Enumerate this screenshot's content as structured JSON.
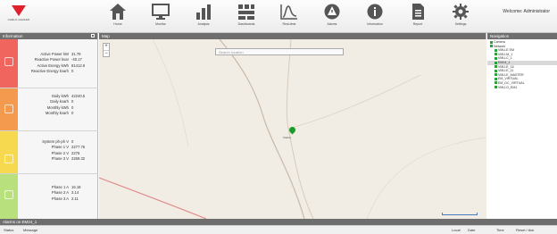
{
  "brand": {
    "logo_text": "CARLO GAVAZZI"
  },
  "toolbar": {
    "items": [
      {
        "label": "Home",
        "icon": "home-icon"
      },
      {
        "label": "Monitor",
        "icon": "monitor-icon"
      },
      {
        "label": "Analysis",
        "icon": "bar-chart-icon"
      },
      {
        "label": "Dashboards",
        "icon": "dashboard-icon"
      },
      {
        "label": "Real-time",
        "icon": "line-chart-icon"
      },
      {
        "label": "Alarms",
        "icon": "alarm-icon"
      },
      {
        "label": "Information",
        "icon": "info-icon"
      },
      {
        "label": "Report",
        "icon": "report-icon"
      },
      {
        "label": "Settings",
        "icon": "gear-icon"
      }
    ],
    "welcome": "Welcome: Administrator"
  },
  "info_panel": {
    "title": "Information",
    "sections": [
      {
        "rows": [
          {
            "label": "Active Power kW",
            "value": "31.79"
          },
          {
            "label": "Reactive Power kvar",
            "value": "-40.17"
          },
          {
            "label": "Active Energy kWh",
            "value": "81412.9"
          },
          {
            "label": "Reactive Energy kvarh",
            "value": "0"
          }
        ]
      },
      {
        "rows": [
          {
            "label": "Daily kWh",
            "value": "42240.5"
          },
          {
            "label": "Daily kvarh",
            "value": "0"
          },
          {
            "label": "Monthly kWh",
            "value": "0"
          },
          {
            "label": "Monthly kvarh",
            "value": "0"
          }
        ]
      },
      {
        "rows": [
          {
            "label": "System ph-ph V",
            "value": "0"
          },
          {
            "label": "Phase 1 V",
            "value": "2277.75"
          },
          {
            "label": "Phase 2 V",
            "value": "2276"
          },
          {
            "label": "Phase 3 V",
            "value": "2269.32"
          }
        ]
      },
      {
        "rows": [
          {
            "label": "Phase 1 A",
            "value": "16.18"
          },
          {
            "label": "Phase 2 A",
            "value": "3.14"
          },
          {
            "label": "Phase 3 A",
            "value": "2.11"
          }
        ]
      }
    ],
    "colors": {
      "red": "#f0655e",
      "orange": "#f49a4f",
      "yellow": "#f6d94e",
      "green": "#b8e07c"
    }
  },
  "map_panel": {
    "title": "Map",
    "search_placeholder": "Search location",
    "zoom_in": "+",
    "zoom_out": "−",
    "marker_label": "Station"
  },
  "nav_panel": {
    "title": "Navigation",
    "tree": [
      {
        "label": "Camera",
        "indent": 0
      },
      {
        "label": "Network",
        "indent": 0
      },
      {
        "label": "VMU-E EM",
        "indent": 1
      },
      {
        "label": "VMU-M_1",
        "indent": 1
      },
      {
        "label": "VMU-C_1",
        "indent": 1
      },
      {
        "label": "EM24_1",
        "indent": 1,
        "selected": true
      },
      {
        "label": "VMU-E_16",
        "indent": 1
      },
      {
        "label": "VMU-E_11",
        "indent": 1
      },
      {
        "label": "VMU-E_MASTER",
        "indent": 1
      },
      {
        "label": "EM_VIRTUAL",
        "indent": 1
      },
      {
        "label": "EM_DC_VIRTUAL",
        "indent": 1
      },
      {
        "label": "VMU-O_EM1",
        "indent": 1
      }
    ]
  },
  "bottom": {
    "header": "Alarms on EM24_1",
    "status_label": "Status",
    "message_label": "Message",
    "col_local": "Local",
    "col_date": "Date",
    "col_time": "Time",
    "col_reset": "Reset / Ack"
  }
}
